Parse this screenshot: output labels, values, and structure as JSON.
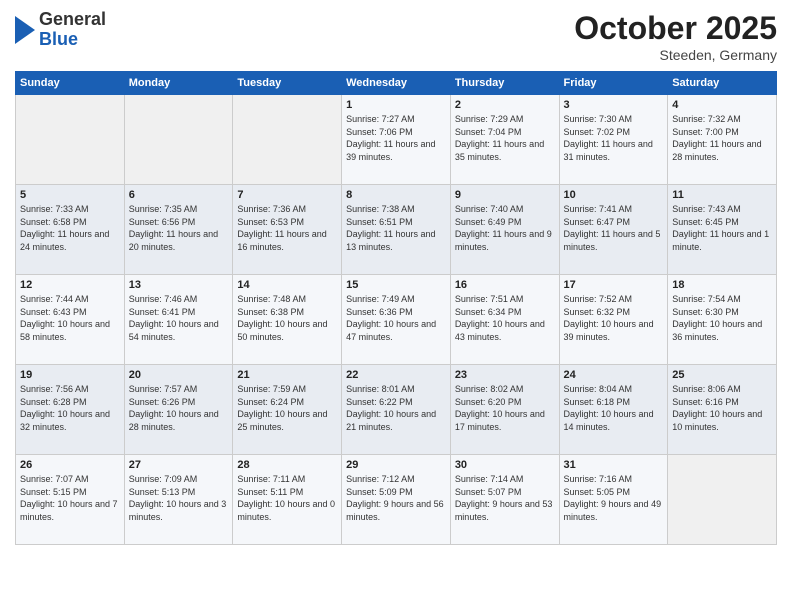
{
  "header": {
    "logo": {
      "general": "General",
      "blue": "Blue"
    },
    "title": "October 2025",
    "location": "Steeden, Germany"
  },
  "weekdays": [
    "Sunday",
    "Monday",
    "Tuesday",
    "Wednesday",
    "Thursday",
    "Friday",
    "Saturday"
  ],
  "weeks": [
    [
      {
        "day": "",
        "sunrise": "",
        "sunset": "",
        "daylight": ""
      },
      {
        "day": "",
        "sunrise": "",
        "sunset": "",
        "daylight": ""
      },
      {
        "day": "",
        "sunrise": "",
        "sunset": "",
        "daylight": ""
      },
      {
        "day": "1",
        "sunrise": "Sunrise: 7:27 AM",
        "sunset": "Sunset: 7:06 PM",
        "daylight": "Daylight: 11 hours and 39 minutes."
      },
      {
        "day": "2",
        "sunrise": "Sunrise: 7:29 AM",
        "sunset": "Sunset: 7:04 PM",
        "daylight": "Daylight: 11 hours and 35 minutes."
      },
      {
        "day": "3",
        "sunrise": "Sunrise: 7:30 AM",
        "sunset": "Sunset: 7:02 PM",
        "daylight": "Daylight: 11 hours and 31 minutes."
      },
      {
        "day": "4",
        "sunrise": "Sunrise: 7:32 AM",
        "sunset": "Sunset: 7:00 PM",
        "daylight": "Daylight: 11 hours and 28 minutes."
      }
    ],
    [
      {
        "day": "5",
        "sunrise": "Sunrise: 7:33 AM",
        "sunset": "Sunset: 6:58 PM",
        "daylight": "Daylight: 11 hours and 24 minutes."
      },
      {
        "day": "6",
        "sunrise": "Sunrise: 7:35 AM",
        "sunset": "Sunset: 6:56 PM",
        "daylight": "Daylight: 11 hours and 20 minutes."
      },
      {
        "day": "7",
        "sunrise": "Sunrise: 7:36 AM",
        "sunset": "Sunset: 6:53 PM",
        "daylight": "Daylight: 11 hours and 16 minutes."
      },
      {
        "day": "8",
        "sunrise": "Sunrise: 7:38 AM",
        "sunset": "Sunset: 6:51 PM",
        "daylight": "Daylight: 11 hours and 13 minutes."
      },
      {
        "day": "9",
        "sunrise": "Sunrise: 7:40 AM",
        "sunset": "Sunset: 6:49 PM",
        "daylight": "Daylight: 11 hours and 9 minutes."
      },
      {
        "day": "10",
        "sunrise": "Sunrise: 7:41 AM",
        "sunset": "Sunset: 6:47 PM",
        "daylight": "Daylight: 11 hours and 5 minutes."
      },
      {
        "day": "11",
        "sunrise": "Sunrise: 7:43 AM",
        "sunset": "Sunset: 6:45 PM",
        "daylight": "Daylight: 11 hours and 1 minute."
      }
    ],
    [
      {
        "day": "12",
        "sunrise": "Sunrise: 7:44 AM",
        "sunset": "Sunset: 6:43 PM",
        "daylight": "Daylight: 10 hours and 58 minutes."
      },
      {
        "day": "13",
        "sunrise": "Sunrise: 7:46 AM",
        "sunset": "Sunset: 6:41 PM",
        "daylight": "Daylight: 10 hours and 54 minutes."
      },
      {
        "day": "14",
        "sunrise": "Sunrise: 7:48 AM",
        "sunset": "Sunset: 6:38 PM",
        "daylight": "Daylight: 10 hours and 50 minutes."
      },
      {
        "day": "15",
        "sunrise": "Sunrise: 7:49 AM",
        "sunset": "Sunset: 6:36 PM",
        "daylight": "Daylight: 10 hours and 47 minutes."
      },
      {
        "day": "16",
        "sunrise": "Sunrise: 7:51 AM",
        "sunset": "Sunset: 6:34 PM",
        "daylight": "Daylight: 10 hours and 43 minutes."
      },
      {
        "day": "17",
        "sunrise": "Sunrise: 7:52 AM",
        "sunset": "Sunset: 6:32 PM",
        "daylight": "Daylight: 10 hours and 39 minutes."
      },
      {
        "day": "18",
        "sunrise": "Sunrise: 7:54 AM",
        "sunset": "Sunset: 6:30 PM",
        "daylight": "Daylight: 10 hours and 36 minutes."
      }
    ],
    [
      {
        "day": "19",
        "sunrise": "Sunrise: 7:56 AM",
        "sunset": "Sunset: 6:28 PM",
        "daylight": "Daylight: 10 hours and 32 minutes."
      },
      {
        "day": "20",
        "sunrise": "Sunrise: 7:57 AM",
        "sunset": "Sunset: 6:26 PM",
        "daylight": "Daylight: 10 hours and 28 minutes."
      },
      {
        "day": "21",
        "sunrise": "Sunrise: 7:59 AM",
        "sunset": "Sunset: 6:24 PM",
        "daylight": "Daylight: 10 hours and 25 minutes."
      },
      {
        "day": "22",
        "sunrise": "Sunrise: 8:01 AM",
        "sunset": "Sunset: 6:22 PM",
        "daylight": "Daylight: 10 hours and 21 minutes."
      },
      {
        "day": "23",
        "sunrise": "Sunrise: 8:02 AM",
        "sunset": "Sunset: 6:20 PM",
        "daylight": "Daylight: 10 hours and 17 minutes."
      },
      {
        "day": "24",
        "sunrise": "Sunrise: 8:04 AM",
        "sunset": "Sunset: 6:18 PM",
        "daylight": "Daylight: 10 hours and 14 minutes."
      },
      {
        "day": "25",
        "sunrise": "Sunrise: 8:06 AM",
        "sunset": "Sunset: 6:16 PM",
        "daylight": "Daylight: 10 hours and 10 minutes."
      }
    ],
    [
      {
        "day": "26",
        "sunrise": "Sunrise: 7:07 AM",
        "sunset": "Sunset: 5:15 PM",
        "daylight": "Daylight: 10 hours and 7 minutes."
      },
      {
        "day": "27",
        "sunrise": "Sunrise: 7:09 AM",
        "sunset": "Sunset: 5:13 PM",
        "daylight": "Daylight: 10 hours and 3 minutes."
      },
      {
        "day": "28",
        "sunrise": "Sunrise: 7:11 AM",
        "sunset": "Sunset: 5:11 PM",
        "daylight": "Daylight: 10 hours and 0 minutes."
      },
      {
        "day": "29",
        "sunrise": "Sunrise: 7:12 AM",
        "sunset": "Sunset: 5:09 PM",
        "daylight": "Daylight: 9 hours and 56 minutes."
      },
      {
        "day": "30",
        "sunrise": "Sunrise: 7:14 AM",
        "sunset": "Sunset: 5:07 PM",
        "daylight": "Daylight: 9 hours and 53 minutes."
      },
      {
        "day": "31",
        "sunrise": "Sunrise: 7:16 AM",
        "sunset": "Sunset: 5:05 PM",
        "daylight": "Daylight: 9 hours and 49 minutes."
      },
      {
        "day": "",
        "sunrise": "",
        "sunset": "",
        "daylight": ""
      }
    ]
  ]
}
